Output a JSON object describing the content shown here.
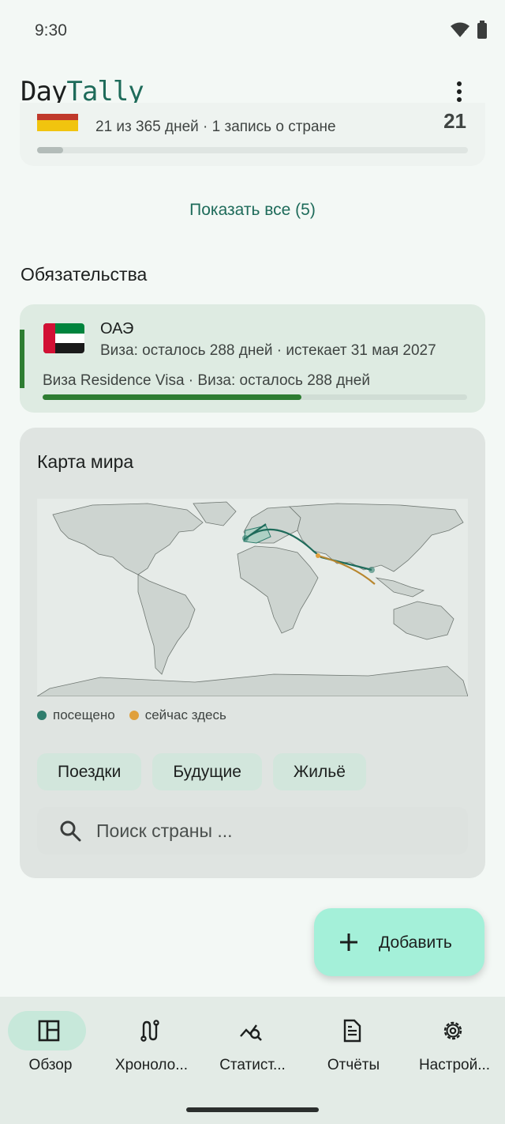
{
  "status": {
    "time": "9:30"
  },
  "app": {
    "logo_day": "Day",
    "logo_tally": "Tally"
  },
  "top_card": {
    "subtitle": "21 из 365 дней  ·  1 запись о стране",
    "count": "21",
    "progress": 0.06
  },
  "show_all": "Показать все (5)",
  "commitments": {
    "title": "Обязательства",
    "item": {
      "country": "ОАЭ",
      "subtitle": "Виза: осталось 288 дней · истекает 31 мая 2027",
      "detail": "Виза Residence Visa · Виза: осталось 288 дней",
      "progress": 0.61
    }
  },
  "map": {
    "title": "Карта мира",
    "legend": {
      "visited": "посещено",
      "current": "сейчас здесь"
    },
    "chips": [
      "Поездки",
      "Будущие",
      "Жильё"
    ],
    "search_placeholder": "Поиск страны ...",
    "colors": {
      "visited": "#2f7d6d",
      "current": "#e0a03c",
      "route": "#1e6b5a",
      "route_future": "#b8862e"
    }
  },
  "fab": {
    "label": "Добавить"
  },
  "nav": [
    {
      "label": "Обзор",
      "icon": "dashboard-icon",
      "active": true
    },
    {
      "label": "Хроноло...",
      "icon": "timeline-icon",
      "active": false
    },
    {
      "label": "Статист...",
      "icon": "stats-icon",
      "active": false
    },
    {
      "label": "Отчёты",
      "icon": "report-icon",
      "active": false
    },
    {
      "label": "Настрой...",
      "icon": "settings-icon",
      "active": false
    }
  ]
}
